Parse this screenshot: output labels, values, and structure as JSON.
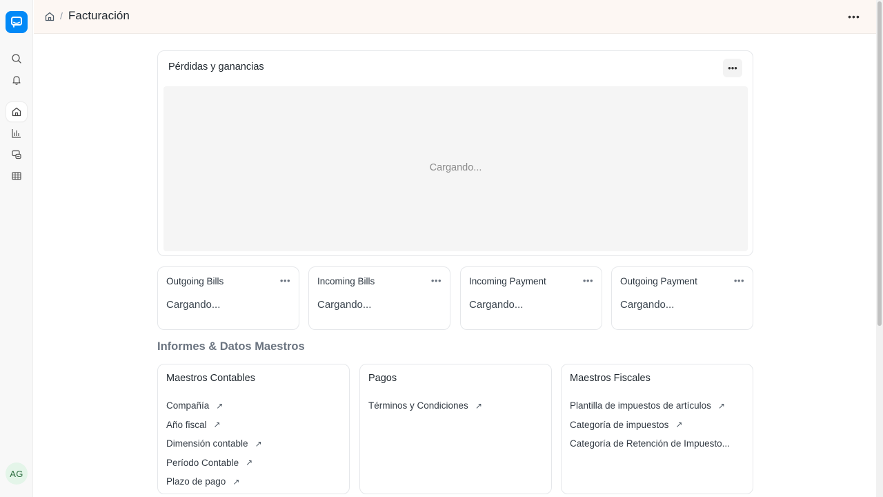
{
  "app": {
    "breadcrumb_sep": "/",
    "title": "Facturación",
    "avatar_initials": "AG",
    "more_icon": "•••",
    "accent_color": "#0289f7"
  },
  "sidebar": {
    "items": [
      {
        "icon": "search-icon"
      },
      {
        "icon": "bell-icon"
      },
      {
        "icon": "home-icon",
        "active": true
      },
      {
        "icon": "bar-chart-icon"
      },
      {
        "icon": "stack-icon"
      },
      {
        "icon": "table-icon"
      }
    ]
  },
  "chart_card": {
    "title": "Pérdidas y ganancias",
    "loading": "Cargando..."
  },
  "number_cards": [
    {
      "title": "Outgoing Bills",
      "value": "Cargando..."
    },
    {
      "title": "Incoming Bills",
      "value": "Cargando..."
    },
    {
      "title": "Incoming Payment",
      "value": "Cargando..."
    },
    {
      "title": "Outgoing Payment",
      "value": "Cargando..."
    }
  ],
  "section": {
    "title": "Informes & Datos Maestros"
  },
  "link_cards": [
    {
      "title": "Maestros Contables",
      "links": [
        "Compañía",
        "Año fiscal",
        "Dimensión contable",
        "Período Contable",
        "Plazo de pago"
      ]
    },
    {
      "title": "Pagos",
      "links": [
        "Términos y Condiciones"
      ]
    },
    {
      "title": "Maestros Fiscales",
      "links": [
        "Plantilla de impuestos de artículos",
        "Categoría de impuestos",
        "Categoría de Retención de Impuesto..."
      ]
    }
  ],
  "link_arrow": "↗"
}
